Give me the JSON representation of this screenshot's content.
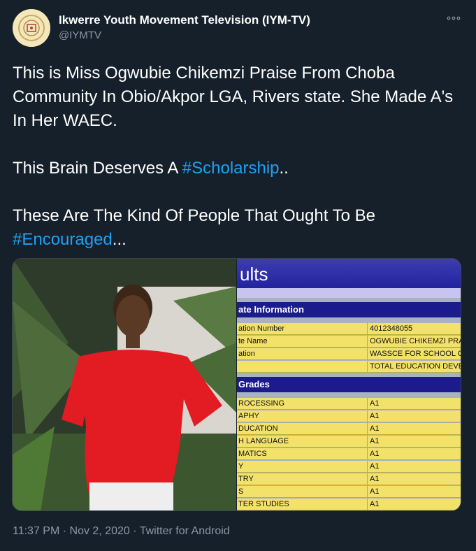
{
  "author": {
    "display_name": "Ikwerre Youth Movement Television (IYM-TV)",
    "handle": "@IYMTV"
  },
  "tweet": {
    "line1": "This is Miss Ogwubie Chikemzi Praise From Choba Community In Obio/Akpor LGA, Rivers state. She Made A's In Her WAEC.",
    "p2_text": "This Brain Deserves A ",
    "p2_hashtag": "#Scholarship",
    "p2_suffix": "..",
    "p3_text": "These Are The Kind Of People That Ought To Be ",
    "p3_hashtag": "#Encouraged",
    "p3_suffix": "..."
  },
  "results_screenshot": {
    "title": "ults",
    "section1_header": "ate Information",
    "info_rows": [
      {
        "label": "ation Number",
        "value": "4012348055"
      },
      {
        "label": "te Name",
        "value": "OGWUBIE CHIKEMZI PRA"
      },
      {
        "label": "ation",
        "value": "WASSCE FOR SCHOOL C"
      },
      {
        "label": "",
        "value": "TOTAL EDUCATION DEVE"
      }
    ],
    "section2_header": "Grades",
    "grade_rows": [
      {
        "subject": "ROCESSING",
        "grade": "A1"
      },
      {
        "subject": "APHY",
        "grade": "A1"
      },
      {
        "subject": "DUCATION",
        "grade": "A1"
      },
      {
        "subject": "H LANGUAGE",
        "grade": "A1"
      },
      {
        "subject": "MATICS",
        "grade": "A1"
      },
      {
        "subject": "Y",
        "grade": "A1"
      },
      {
        "subject": "TRY",
        "grade": "A1"
      },
      {
        "subject": "S",
        "grade": "A1"
      },
      {
        "subject": "TER STUDIES",
        "grade": "A1"
      }
    ]
  },
  "footer": {
    "time": "11:37 PM",
    "sep1": " · ",
    "date": "Nov 2, 2020",
    "sep2": " · ",
    "source": "Twitter for Android"
  },
  "colors": {
    "background": "#15202b",
    "text_primary": "#ffffff",
    "text_secondary": "#8899a6",
    "hashtag": "#1da1f2"
  }
}
